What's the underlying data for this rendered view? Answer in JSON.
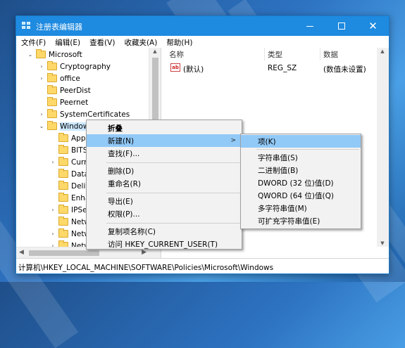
{
  "window": {
    "title": "注册表编辑器",
    "accent": "#1e8ae0"
  },
  "titlebar": {
    "min_icon": "minimize-icon",
    "max_icon": "maximize-icon",
    "close_icon": "close-icon",
    "close_glyph": "✕"
  },
  "menubar": {
    "items": [
      "文件(F)",
      "编辑(E)",
      "查看(V)",
      "收藏夹(A)",
      "帮助(H)"
    ]
  },
  "tree": {
    "items": [
      {
        "label": "Microsoft",
        "arrow": "v"
      },
      {
        "label": "Cryptography",
        "arrow": ">"
      },
      {
        "label": "office",
        "arrow": ">"
      },
      {
        "label": "PeerDist",
        "arrow": ""
      },
      {
        "label": "Peernet",
        "arrow": ""
      },
      {
        "label": "SystemCertificates",
        "arrow": ">"
      },
      {
        "label": "Window",
        "arrow": "v"
      },
      {
        "label": "Appx",
        "arrow": ""
      },
      {
        "label": "BITS",
        "arrow": ""
      },
      {
        "label": "Curre",
        "arrow": ">"
      },
      {
        "label": "Data",
        "arrow": ""
      },
      {
        "label": "Deliv",
        "arrow": ""
      },
      {
        "label": "Enha",
        "arrow": ""
      },
      {
        "label": "IPSec",
        "arrow": ">"
      },
      {
        "label": "Netw",
        "arrow": ""
      },
      {
        "label": "Netw",
        "arrow": ">"
      },
      {
        "label": "Netw",
        "arrow": ">"
      }
    ]
  },
  "list": {
    "columns": {
      "name": "名称",
      "type": "类型",
      "data": "数据"
    },
    "rows": [
      {
        "icon": "string-value-icon",
        "icon_text": "ab",
        "name": "(默认)",
        "type": "REG_SZ",
        "data": "(数值未设置)"
      }
    ]
  },
  "context_menu": {
    "items": [
      "折叠",
      "新建(N)",
      "查找(F)...",
      "删除(D)",
      "重命名(R)",
      "导出(E)",
      "权限(P)...",
      "复制项名称(C)",
      "访问 HKEY_CURRENT_USER(T)"
    ],
    "submenu_arrow": ">"
  },
  "submenu": {
    "items": [
      "项(K)",
      "字符串值(S)",
      "二进制值(B)",
      "DWORD (32 位)值(D)",
      "QWORD (64 位)值(Q)",
      "多字符串值(M)",
      "可扩充字符串值(E)"
    ]
  },
  "statusbar": {
    "path": "计算机\\HKEY_LOCAL_MACHINE\\SOFTWARE\\Policies\\Microsoft\\Windows"
  },
  "scroll": {
    "up": "▲",
    "down": "▼",
    "left": "◀",
    "right": "▶"
  }
}
